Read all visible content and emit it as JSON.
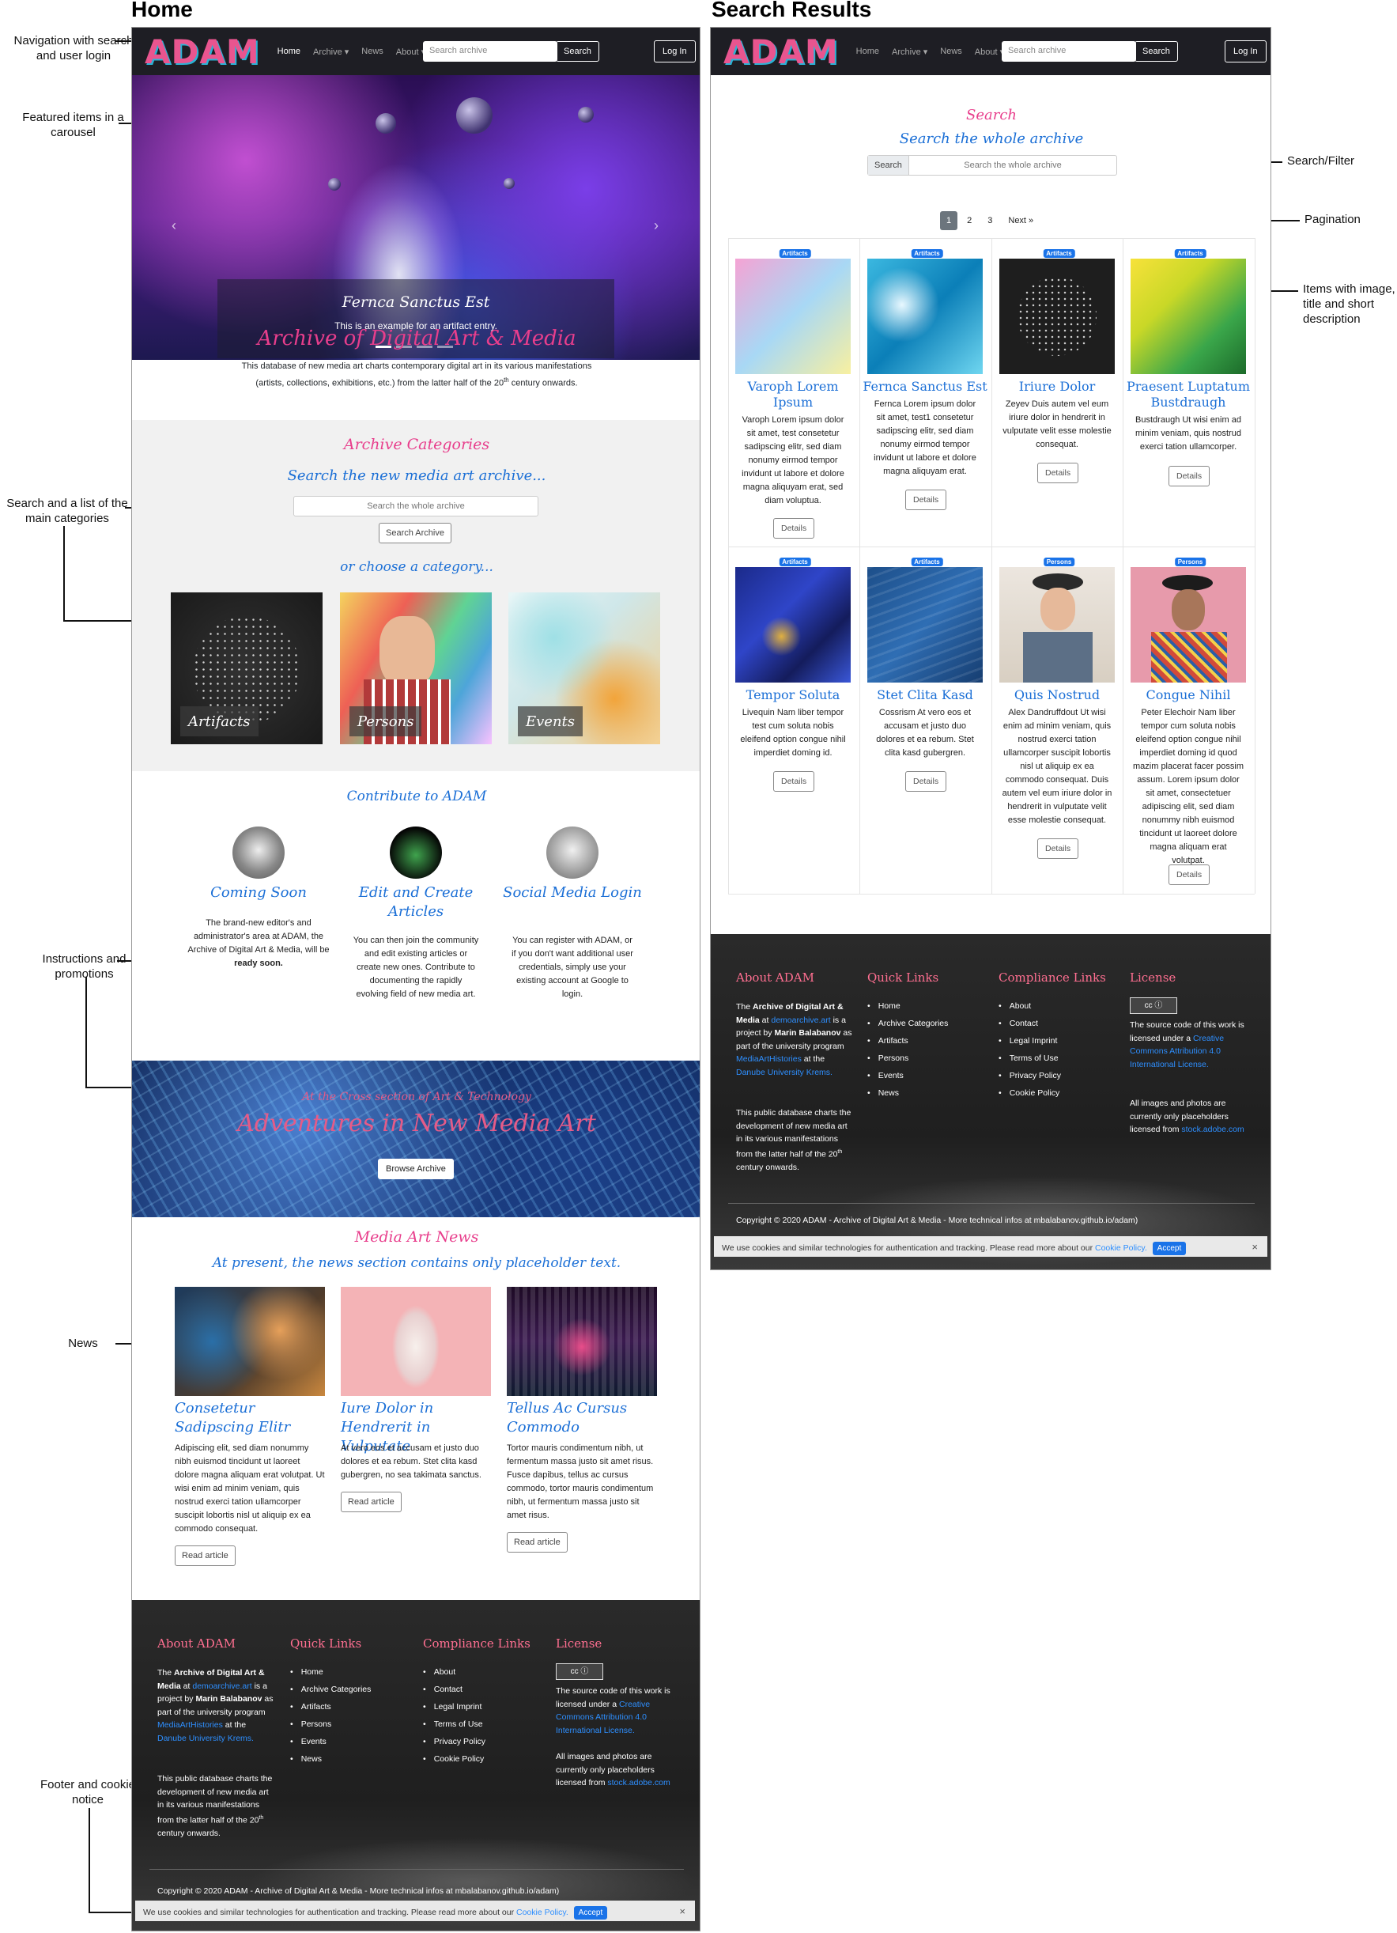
{
  "headings": {
    "home": "Home",
    "search": "Search Results"
  },
  "annotations": {
    "nav": "Navigation with search and user login",
    "carousel": "Featured items in a carousel",
    "search_categories": "Search and a list of the main categories",
    "instructions": "Instructions and promotions",
    "news": "News",
    "footer": "Footer and cookie notice",
    "search_filter": "Search/Filter",
    "pagination": "Pagination",
    "items": "Items with image, title and short description"
  },
  "navbar": {
    "logo": "ADAM",
    "links": [
      "Home",
      "Archive ▾",
      "News",
      "About ▾"
    ],
    "search_placeholder": "Search archive",
    "search_button": "Search",
    "login_button": "Log In"
  },
  "carousel": {
    "title": "Fernca Sanctus Est",
    "text": "This is an example for an artifact entry.",
    "indicators": 4,
    "active_indicator": 0
  },
  "intro": {
    "title": "Archive of Digital Art & Media",
    "text_before_sup": "This database of new media art charts contemporary digital art in its various manifestations (artists, collections, exhibitions, etc.) from the latter half of the 20",
    "sup": "th",
    "text_after_sup": " century onwards."
  },
  "categories": {
    "title": "Archive Categories",
    "subtitle": "Search the new media art archive...",
    "search_placeholder": "Search the whole archive",
    "search_button": "Search Archive",
    "choose": "or choose a category...",
    "items": [
      "Artifacts",
      "Persons",
      "Events"
    ]
  },
  "contribute": {
    "title": "Contribute to ADAM",
    "items": [
      {
        "title": "Coming Soon",
        "text": "The brand-new editor's and administrator's area at ADAM, the Archive of Digital Art & Media, will be ",
        "bold": "ready soon."
      },
      {
        "title": "Edit and Create Articles",
        "text": "You can then join the community and edit existing articles or create new ones. Contribute to documenting the rapidly evolving field of new media art.",
        "bold": ""
      },
      {
        "title": "Social Media Login",
        "text": "You can register with ADAM, or if you don't want additional user credentials, simply use your existing account at Google to login.",
        "bold": ""
      }
    ]
  },
  "banner": {
    "kicker": "At the Cross section of Art & Technology",
    "title": "Adventures in New Media Art",
    "button": "Browse Archive"
  },
  "news": {
    "title": "Media Art News",
    "subtitle": "At present, the news section contains only placeholder text.",
    "read_label": "Read article",
    "items": [
      {
        "title": "Consetetur Sadipscing Elitr",
        "text": "Adipiscing elit, sed diam nonummy nibh euismod tincidunt ut laoreet dolore magna aliquam erat volutpat. Ut wisi enim ad minim veniam, quis nostrud exerci tation ullamcorper suscipit lobortis nisl ut aliquip ex ea commodo consequat."
      },
      {
        "title": "Iure Dolor in Hendrerit in Vulputate",
        "text": "At vero eos et accusam et justo duo dolores et ea rebum. Stet clita kasd gubergren, no sea takimata sanctus."
      },
      {
        "title": "Tellus Ac Cursus Commodo",
        "text": "Tortor mauris condimentum nibh, ut fermentum massa justo sit amet risus. Fusce dapibus, tellus ac cursus commodo, tortor mauris condimentum nibh, ut fermentum massa justo sit amet risus."
      }
    ]
  },
  "footer": {
    "about_title": "About ADAM",
    "about_p1_a": "The ",
    "about_p1_b": "Archive of Digital Art & Media",
    "about_p1_c": " at ",
    "about_link": "demoarchive.art",
    "about_p1_d": " is a project by ",
    "about_p1_e": "Marin Balabanov",
    "about_p1_f": " as part of the university program ",
    "about_link2": "MediaArtHistories",
    "about_p1_g": " at the ",
    "about_link3": "Danube University Krems.",
    "about_p2": "This public database charts the development of new media art in its various manifestations from the latter half of the 20",
    "about_p2_sup": "th",
    "about_p2_end": " century onwards.",
    "quick_title": "Quick Links",
    "quick_links": [
      "Home",
      "Archive Categories",
      "Artifacts",
      "Persons",
      "Events",
      "News"
    ],
    "compliance_title": "Compliance Links",
    "compliance_links": [
      "About",
      "Contact",
      "Legal Imprint",
      "Terms of Use",
      "Privacy Policy",
      "Cookie Policy"
    ],
    "license_title": "License",
    "license_badge": "cc ⓘ",
    "license_text": "The source code of this work is licensed under a ",
    "license_link": "Creative Commons Attribution 4.0 International License.",
    "images_text": "All images and photos are currently only placeholders licensed from ",
    "images_link": "stock.adobe.com",
    "copyright": "Copyright © 2020 ADAM - Archive of Digital Art & Media - More technical infos at mbalabanov.github.io/adam)"
  },
  "cookie": {
    "text": "We use cookies and similar technologies for authentication and tracking. Please read more about our ",
    "link": "Cookie Policy.",
    "accept": "Accept",
    "close": "×"
  },
  "search_page": {
    "title": "Search",
    "subtitle": "Search the whole archive",
    "prefix": "Search",
    "placeholder": "Search the whole archive",
    "pages": [
      "1",
      "2",
      "3",
      "Next »"
    ],
    "active_page": "1",
    "details_label": "Details",
    "items": [
      {
        "badge": "Artifacts",
        "title": "Varoph Lorem Ipsum",
        "text": "Varoph Lorem ipsum dolor sit amet, test consetetur sadipscing elitr, sed diam nonumy eirmod tempor invidunt ut labore et dolore magna aliquyam erat, sed diam voluptua."
      },
      {
        "badge": "Artifacts",
        "title": "Fernca Sanctus Est",
        "text": "Fernca Lorem ipsum dolor sit amet, test1 consetetur sadipscing elitr, sed diam nonumy eirmod tempor invidunt ut labore et dolore magna aliquyam erat."
      },
      {
        "badge": "Artifacts",
        "title": "Iriure Dolor",
        "text": "Zeyev Duis autem vel eum iriure dolor in hendrerit in vulputate velit esse molestie consequat."
      },
      {
        "badge": "Artifacts",
        "title": "Praesent Luptatum Bustdraugh",
        "text": "Bustdraugh Ut wisi enim ad minim veniam, quis nostrud exerci tation ullamcorper."
      },
      {
        "badge": "Artifacts",
        "title": "Tempor Soluta",
        "text": "Livequin Nam liber tempor test cum soluta nobis eleifend option congue nihil imperdiet doming id."
      },
      {
        "badge": "Artifacts",
        "title": "Stet Clita Kasd",
        "text": "Cossrism At vero eos et accusam et justo duo dolores et ea rebum. Stet clita kasd gubergren."
      },
      {
        "badge": "Persons",
        "title": "Quis Nostrud",
        "text": "Alex Dandruffdout Ut wisi enim ad minim veniam, quis nostrud exerci tation ullamcorper suscipit lobortis nisl ut aliquip ex ea commodo consequat. Duis autem vel eum iriure dolor in hendrerit in vulputate velit esse molestie consequat."
      },
      {
        "badge": "Persons",
        "title": "Congue Nihil",
        "text": "Peter Elechoir Nam liber tempor cum soluta nobis eleifend option congue nihil imperdiet doming id quod mazim placerat facer possim assum. Lorem ipsum dolor sit amet, consectetuer adipiscing elit, sed diam nonummy nibh euismod tincidunt ut laoreet dolore magna aliquam erat volutpat."
      }
    ]
  }
}
